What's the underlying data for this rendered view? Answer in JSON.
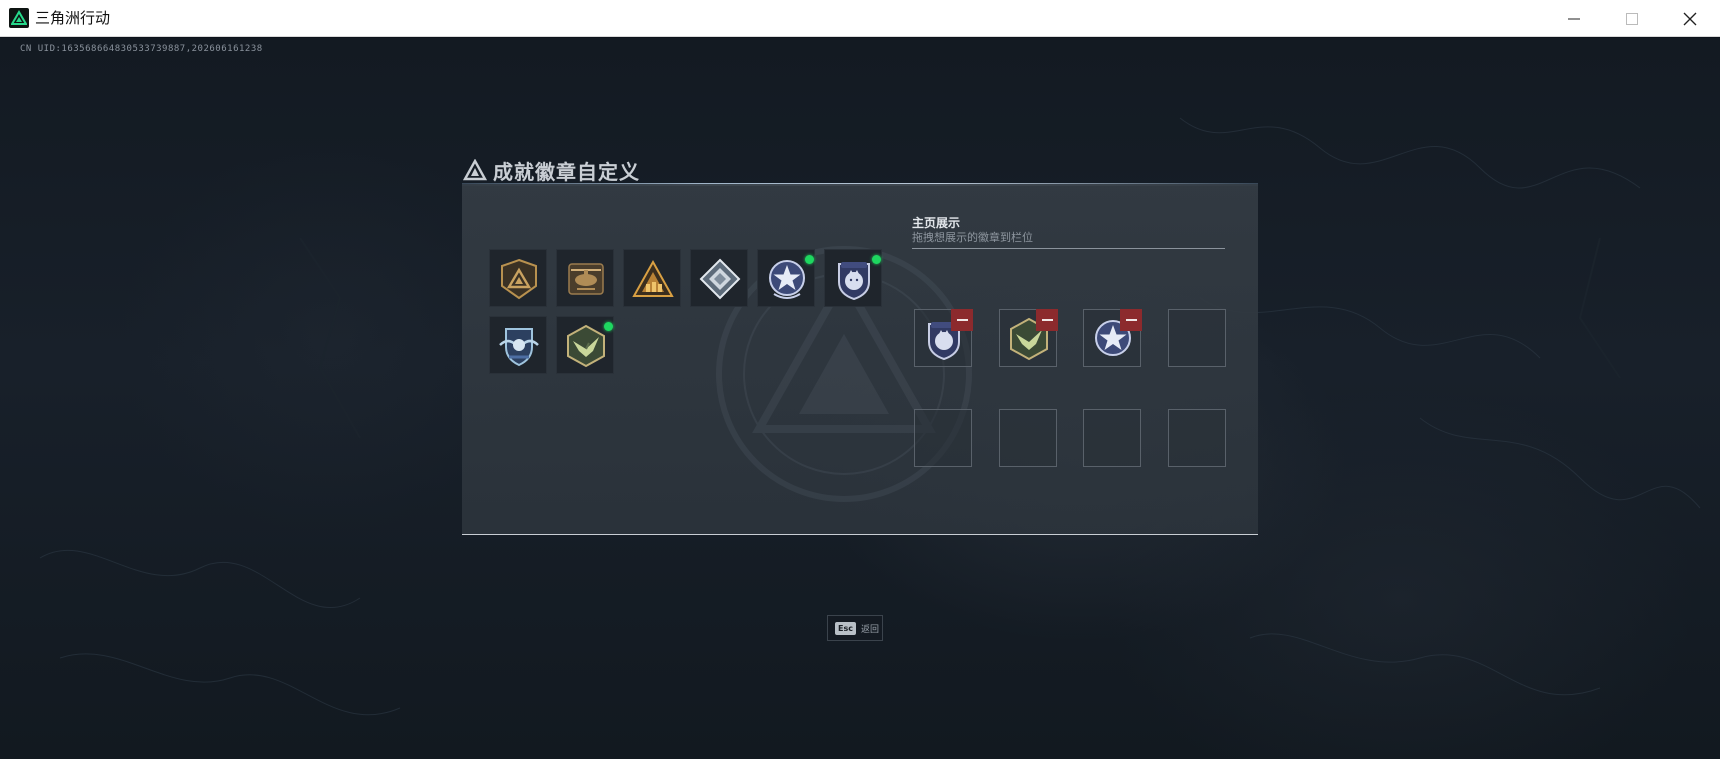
{
  "window": {
    "title": "三角洲行动",
    "controls": {
      "minimize": "minimize-icon",
      "maximize": "maximize-icon",
      "close": "close-icon"
    }
  },
  "uid_text": "CN UID:163568664830533739887,202606161238",
  "panel": {
    "title": "成就徽章自定义",
    "owned_badges": [
      {
        "icon": "delta-emblem-badge-icon",
        "new": false
      },
      {
        "icon": "helicopter-badge-icon",
        "new": false
      },
      {
        "icon": "mountain-squad-badge-icon",
        "new": false
      },
      {
        "icon": "diamond-badge-icon",
        "new": false
      },
      {
        "icon": "star-medal-badge-icon",
        "new": true
      },
      {
        "icon": "wolf-shield-badge-icon",
        "new": true
      },
      {
        "icon": "shield-wings-badge-icon",
        "new": false
      },
      {
        "icon": "hexagon-hawk-badge-icon",
        "new": true
      }
    ],
    "display": {
      "title": "主页展示",
      "subtitle": "拖拽想展示的徽章到栏位",
      "slots": [
        {
          "badge": "wolf-shield-badge-icon",
          "removable": true
        },
        {
          "badge": "hexagon-hawk-badge-icon",
          "removable": true
        },
        {
          "badge": "star-medal-badge-icon",
          "removable": true
        },
        {
          "badge": null,
          "removable": false
        },
        {
          "badge": null,
          "removable": false
        },
        {
          "badge": null,
          "removable": false
        },
        {
          "badge": null,
          "removable": false
        },
        {
          "badge": null,
          "removable": false
        }
      ]
    }
  },
  "footer": {
    "esc_key": "Esc",
    "back_label": "返回"
  },
  "colors": {
    "new_indicator": "#1ed760",
    "remove_button": "#8c2a2d",
    "accent_logo": "#27d98b"
  }
}
